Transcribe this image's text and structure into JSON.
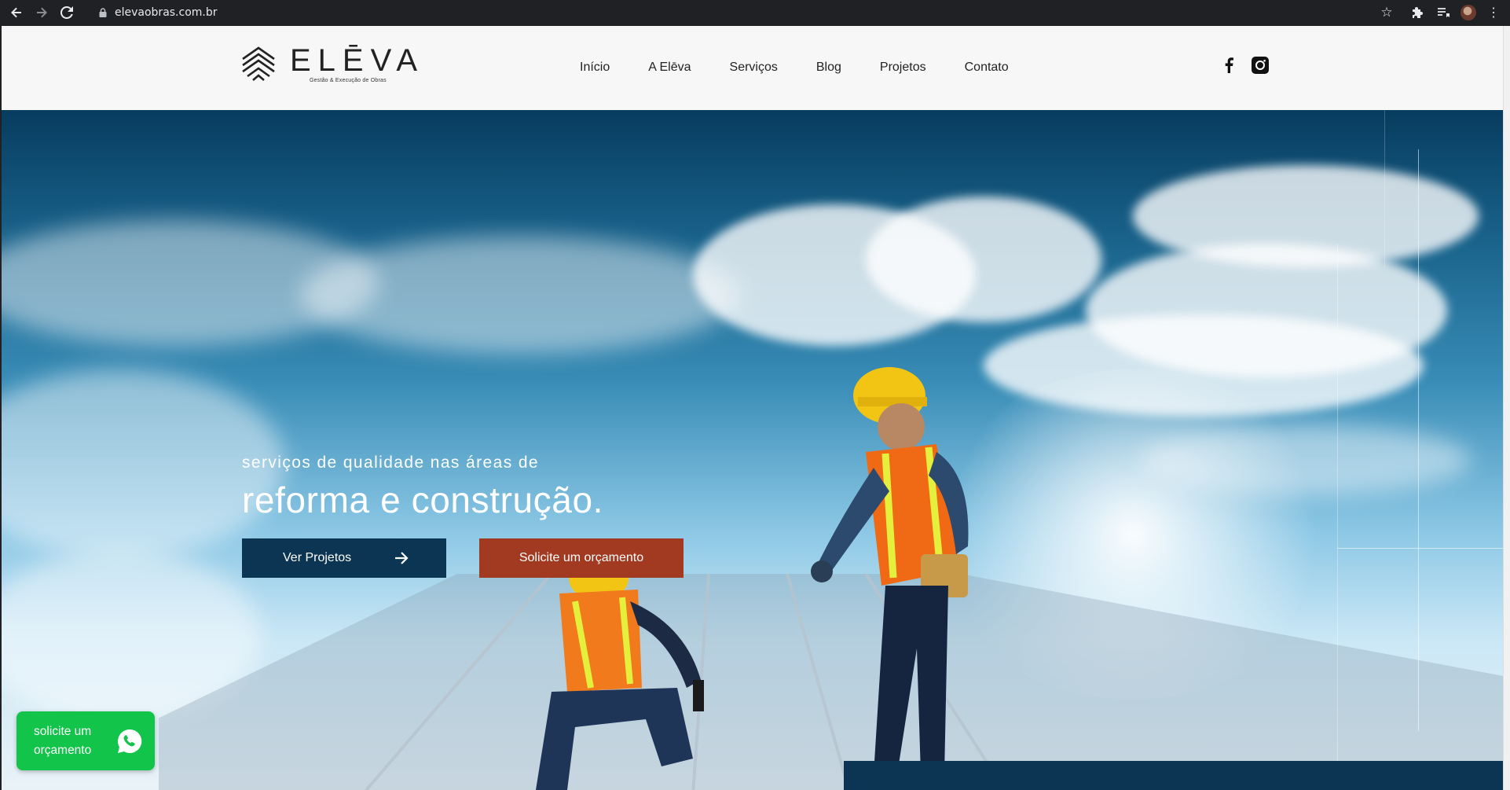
{
  "browser": {
    "url": "elevaobras.com.br",
    "back_icon": "arrow-left-icon",
    "forward_icon": "arrow-right-icon",
    "reload_icon": "reload-icon"
  },
  "site": {
    "logo": {
      "word": "ELĒVA",
      "tagline": "Gestão & Execução de Obras"
    },
    "menu": [
      "Início",
      "A Elēva",
      "Serviços",
      "Blog",
      "Projetos",
      "Contato"
    ],
    "social": [
      "facebook-icon",
      "instagram-icon"
    ]
  },
  "hero": {
    "subtitle": "serviços de qualidade nas áreas de",
    "title": "reforma e construção.",
    "btn_projects": "Ver Projetos",
    "btn_quote": "Solicite um orçamento"
  },
  "whatsapp": {
    "line1": "solicite um",
    "line2": "orçamento"
  },
  "colors": {
    "navy": "#0b3552",
    "rust": "#a13a20",
    "whatsapp": "#12c54a"
  }
}
